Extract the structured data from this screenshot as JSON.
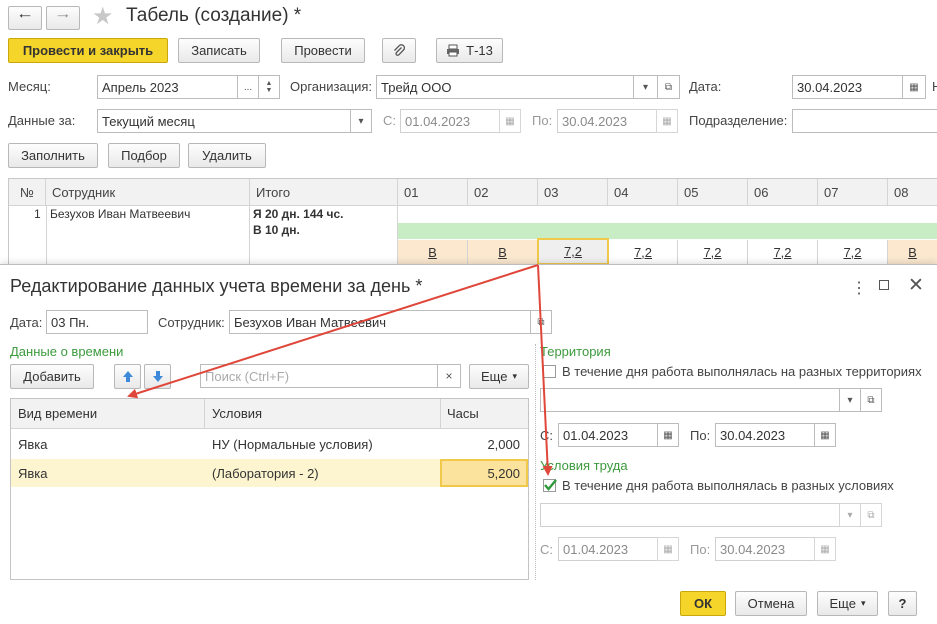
{
  "window": {
    "title": "Табель (создание) *"
  },
  "toolbar": {
    "post_close": "Провести и закрыть",
    "save": "Записать",
    "post": "Провести",
    "report": "Т-13"
  },
  "form": {
    "month_label": "Месяц:",
    "month_value": "Апрель 2023",
    "org_label": "Организация:",
    "org_value": "Трейд ООО",
    "date_label": "Дата:",
    "date_value": "30.04.2023",
    "date_trailing": "Н",
    "period_label": "Данные за:",
    "period_value": "Текущий месяц",
    "from_label": "С:",
    "from_value": "01.04.2023",
    "to_label": "По:",
    "to_value": "30.04.2023",
    "dept_label": "Подразделение:",
    "dept_value": ""
  },
  "actions": {
    "fill": "Заполнить",
    "select": "Подбор",
    "delete": "Удалить"
  },
  "table": {
    "headers": {
      "num": "№",
      "employee": "Сотрудник",
      "total": "Итого"
    },
    "days": [
      "01",
      "02",
      "03",
      "04",
      "05",
      "06",
      "07",
      "08"
    ],
    "row": {
      "num": "1",
      "employee": "Безухов Иван Матвеевич",
      "total_line1": "Я 20 дн. 144 чс.",
      "total_line2": "В 10 дн.",
      "day_values": [
        "В",
        "В",
        "7,2",
        "7,2",
        "7,2",
        "7,2",
        "7,2",
        "В"
      ]
    }
  },
  "dialog": {
    "title": "Редактирование данных учета времени за день *",
    "date_label": "Дата:",
    "date_value": "03 Пн.",
    "employee_label": "Сотрудник:",
    "employee_value": "Безухов Иван Матвеевич",
    "time_group": "Данные о времени",
    "add": "Добавить",
    "search_placeholder": "Поиск (Ctrl+F)",
    "more": "Еще",
    "grid_headers": {
      "kind": "Вид времени",
      "conditions": "Условия",
      "hours": "Часы"
    },
    "grid_rows": [
      {
        "kind": "Явка",
        "conditions": "НУ (Нормальные условия)",
        "hours": "2,000"
      },
      {
        "kind": "Явка",
        "conditions": "(Лаборатория - 2)",
        "hours": "5,200"
      }
    ],
    "territory_group": "Территория",
    "territory_check": "В течение дня работа выполнялась на разных территориях",
    "territory_from_label": "С:",
    "territory_from": "01.04.2023",
    "territory_to_label": "По:",
    "territory_to": "30.04.2023",
    "conditions_group": "Условия труда",
    "conditions_check": "В течение дня работа выполнялась в разных условиях",
    "conditions_from_label": "С:",
    "conditions_from": "01.04.2023",
    "conditions_to_label": "По:",
    "conditions_to": "30.04.2023",
    "ok": "ОК",
    "cancel": "Отмена",
    "more2": "Еще",
    "help": "?"
  },
  "colors": {
    "accent": "#f6d52a",
    "group_green": "#3d9a3d",
    "arrow_red": "#e0473b",
    "selected_row": "#fdf5cf"
  }
}
